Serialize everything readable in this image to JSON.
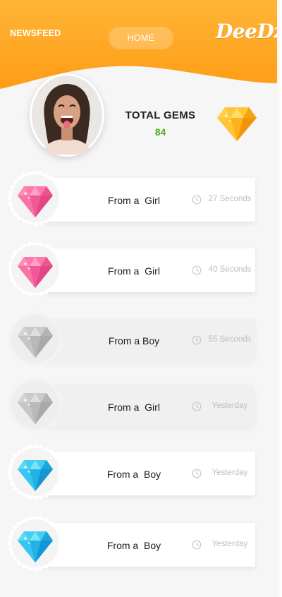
{
  "header": {
    "nav_newsfeed": "NEWSFEED",
    "nav_home": "HOME",
    "brand": "DeeDz",
    "colors": {
      "top": "#ffb233",
      "bottom": "#ff9d12"
    }
  },
  "profile": {
    "avatar": "profile-photo",
    "total_gems_label": "TOTAL GEMS",
    "total_gems_value": "84",
    "gem_icon": "gold-diamond-icon"
  },
  "feed": [
    {
      "gem": "pink-diamond-icon",
      "label": "From a  Girl",
      "time": "27 Seconds",
      "card": "white"
    },
    {
      "gem": "pink-diamond-icon",
      "label": "From a  Girl",
      "time": "40 Seconds",
      "card": "white"
    },
    {
      "gem": "grey-diamond-icon",
      "label": "From a Boy",
      "time": "55 Seconds",
      "card": "grey"
    },
    {
      "gem": "grey-diamond-icon",
      "label": "From a  Girl",
      "time": "Yesterday",
      "card": "grey"
    },
    {
      "gem": "blue-diamond-icon",
      "label": "From a  Boy",
      "time": "Yesterday",
      "card": "white"
    },
    {
      "gem": "blue-diamond-icon",
      "label": "From a  Boy",
      "time": "Yesterday",
      "card": "white"
    }
  ],
  "gem_colors": {
    "pink": {
      "light": "#ff8cb9",
      "mid": "#f5619a",
      "dark": "#e24684"
    },
    "grey": {
      "light": "#d4d4d4",
      "mid": "#bdbdbd",
      "dark": "#a9a9a9"
    },
    "blue": {
      "light": "#5fd9f5",
      "mid": "#22b8e8",
      "dark": "#1396d3"
    },
    "gold": {
      "light": "#ffd24a",
      "mid": "#ffb921",
      "dark": "#f59a0c"
    }
  }
}
